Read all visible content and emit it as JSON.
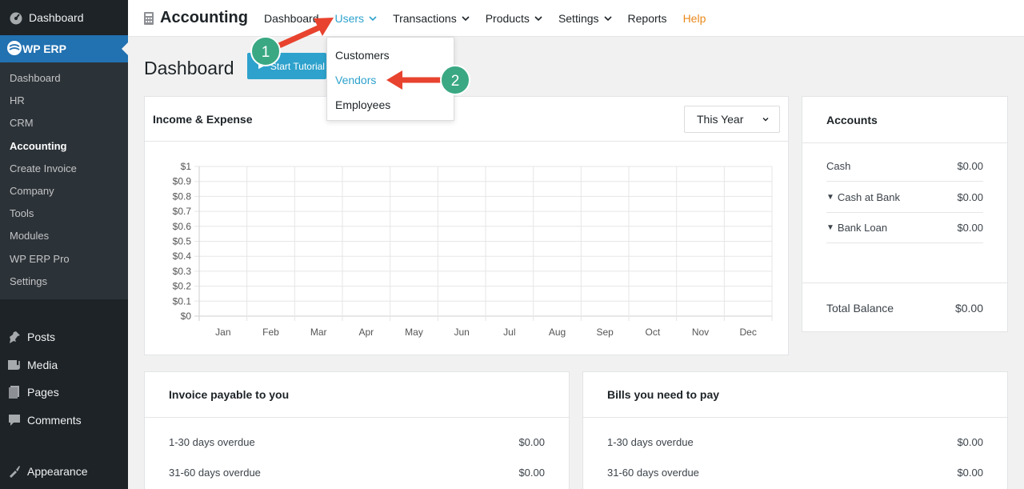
{
  "sidebar": {
    "dashboard_label": "Dashboard",
    "active_label": "WP ERP",
    "submenu": [
      "Dashboard",
      "HR",
      "CRM",
      "Accounting",
      "Create Invoice",
      "Company",
      "Tools",
      "Modules",
      "WP ERP Pro",
      "Settings"
    ],
    "current_submenu": "Accounting",
    "lower_items": [
      {
        "label": "Posts",
        "icon": "pin-icon"
      },
      {
        "label": "Media",
        "icon": "media-icon"
      },
      {
        "label": "Pages",
        "icon": "pages-icon"
      },
      {
        "label": "Comments",
        "icon": "comments-icon"
      }
    ],
    "appearance_label": "Appearance"
  },
  "header": {
    "title": "Accounting",
    "nav": [
      "Dashboard",
      "Users",
      "Transactions",
      "Products",
      "Settings",
      "Reports",
      "Help"
    ],
    "active_nav": "Users",
    "colors": {
      "active": "#2ea2cc",
      "help": "#e8891c"
    }
  },
  "users_menu": {
    "items": [
      "Customers",
      "Vendors",
      "Employees"
    ],
    "highlighted": "Vendors"
  },
  "page": {
    "title": "Dashboard",
    "tutorial_button": "Start Tutorial"
  },
  "income_expense": {
    "title": "Income & Expense",
    "period": "This Year"
  },
  "chart_data": {
    "type": "line",
    "categories": [
      "Jan",
      "Feb",
      "Mar",
      "Apr",
      "May",
      "Jun",
      "Jul",
      "Aug",
      "Sep",
      "Oct",
      "Nov",
      "Dec"
    ],
    "y_ticks": [
      "$0",
      "$0.1",
      "$0.2",
      "$0.3",
      "$0.4",
      "$0.5",
      "$0.6",
      "$0.7",
      "$0.8",
      "$0.9",
      "$1"
    ],
    "ylim": [
      0,
      1
    ],
    "grid": true,
    "series": []
  },
  "accounts": {
    "title": "Accounts",
    "rows": [
      {
        "name": "Cash",
        "value": "$0.00",
        "expandable": false
      },
      {
        "name": "Cash at Bank",
        "value": "$0.00",
        "expandable": true
      },
      {
        "name": "Bank Loan",
        "value": "$0.00",
        "expandable": true
      }
    ],
    "total_label": "Total Balance",
    "total_value": "$0.00"
  },
  "invoice_payable": {
    "title": "Invoice payable to you",
    "rows": [
      {
        "label": "1-30 days overdue",
        "value": "$0.00"
      },
      {
        "label": "31-60 days overdue",
        "value": "$0.00"
      }
    ]
  },
  "bills_to_pay": {
    "title": "Bills you need to pay",
    "rows": [
      {
        "label": "1-30 days overdue",
        "value": "$0.00"
      },
      {
        "label": "31-60 days overdue",
        "value": "$0.00"
      }
    ]
  },
  "annotations": {
    "step1": "1",
    "step2": "2",
    "arrow_color": "#e8432e",
    "badge_color": "#3aa883"
  }
}
